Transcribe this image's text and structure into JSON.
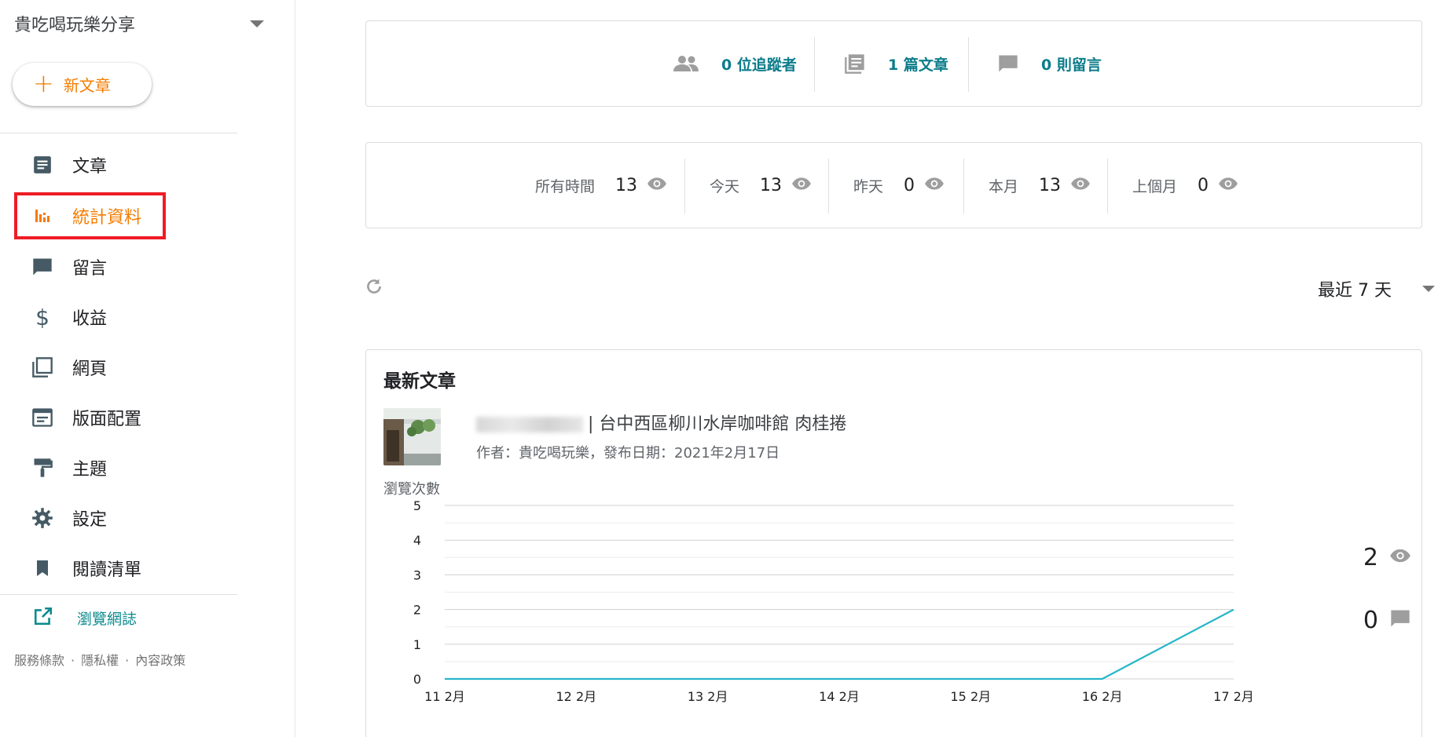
{
  "sidebar": {
    "blog_title": "貴吃喝玩樂分享",
    "new_post_label": "新文章",
    "items": [
      {
        "label": "文章",
        "icon": "posts-icon"
      },
      {
        "label": "統計資料",
        "icon": "stats-icon",
        "active": true
      },
      {
        "label": "留言",
        "icon": "comments-icon"
      },
      {
        "label": "收益",
        "icon": "earnings-icon"
      },
      {
        "label": "網頁",
        "icon": "pages-icon"
      },
      {
        "label": "版面配置",
        "icon": "layout-icon"
      },
      {
        "label": "主題",
        "icon": "theme-icon"
      },
      {
        "label": "設定",
        "icon": "settings-icon"
      },
      {
        "label": "閱讀清單",
        "icon": "reading-list-icon"
      }
    ],
    "view_blog_label": "瀏覽網誌",
    "footer": {
      "terms": "服務條款",
      "privacy": "隱私權",
      "content_policy": "內容政策"
    }
  },
  "summary": {
    "followers": "0 位追蹤者",
    "posts": "1 篇文章",
    "comments": "0 則留言"
  },
  "pageviews": [
    {
      "label": "所有時間",
      "value": "13"
    },
    {
      "label": "今天",
      "value": "13"
    },
    {
      "label": "昨天",
      "value": "0"
    },
    {
      "label": "本月",
      "value": "13"
    },
    {
      "label": "上個月",
      "value": "0"
    }
  ],
  "period_selector": {
    "value": "最近 7 天"
  },
  "latest_post": {
    "section_title": "最新文章",
    "title": "| 台中西區柳川水岸咖啡館 肉桂捲",
    "meta": "作者：貴吃喝玩樂，發布日期：2021年2月17日",
    "views": "2",
    "comments": "0"
  },
  "colors": {
    "accent": "#f57c00",
    "teal": "#0c7c8a",
    "line": "#26b6c9",
    "highlight": "#ee1c25"
  },
  "chart_data": {
    "type": "line",
    "ylabel": "瀏覽次數",
    "categories": [
      "11 2月",
      "12 2月",
      "13 2月",
      "14 2月",
      "15 2月",
      "16 2月",
      "17 2月"
    ],
    "values": [
      0,
      0,
      0,
      0,
      0,
      0,
      2
    ],
    "ylim": [
      0,
      5
    ],
    "yticks": [
      "0",
      "1",
      "2",
      "3",
      "4",
      "5"
    ],
    "grid": true
  }
}
